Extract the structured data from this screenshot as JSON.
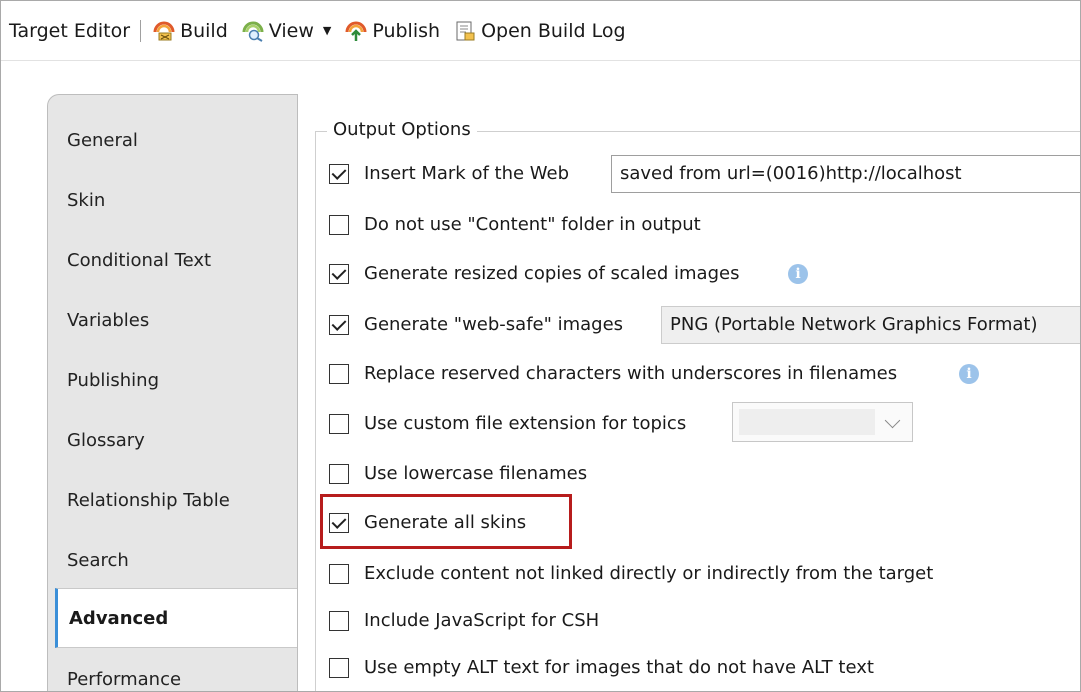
{
  "toolbar": {
    "title": "Target Editor",
    "build": "Build",
    "view": "View",
    "publish": "Publish",
    "open_build_log": "Open Build Log"
  },
  "tabs": [
    {
      "label": "General"
    },
    {
      "label": "Skin"
    },
    {
      "label": "Conditional Text"
    },
    {
      "label": "Variables"
    },
    {
      "label": "Publishing"
    },
    {
      "label": "Glossary"
    },
    {
      "label": "Relationship Table"
    },
    {
      "label": "Search"
    },
    {
      "label": "Advanced",
      "active": true
    },
    {
      "label": "Performance"
    }
  ],
  "output_options": {
    "title": "Output Options",
    "mark_of_web": {
      "label": "Insert Mark of the Web",
      "checked": true,
      "value": "saved from url=(0016)http://localhost"
    },
    "no_content_folder": {
      "label": "Do not use \"Content\" folder in output",
      "checked": false
    },
    "resized_copies": {
      "label": "Generate resized copies of scaled images",
      "checked": true
    },
    "web_safe": {
      "label": "Generate \"web-safe\" images",
      "checked": true,
      "format": "PNG (Portable Network Graphics Format)"
    },
    "replace_reserved": {
      "label": "Replace reserved characters with underscores in filenames",
      "checked": false
    },
    "custom_extension": {
      "label": "Use custom file extension for topics",
      "checked": false,
      "value": ""
    },
    "lowercase": {
      "label": "Use lowercase filenames",
      "checked": false
    },
    "all_skins": {
      "label": "Generate all skins",
      "checked": true
    },
    "exclude_unlinked": {
      "label": "Exclude content not linked directly or indirectly from the target",
      "checked": false
    },
    "javascript_csh": {
      "label": "Include JavaScript for CSH",
      "checked": false
    },
    "empty_alt": {
      "label": "Use empty ALT text for images that do not have ALT text",
      "checked": false
    }
  },
  "colors": {
    "highlight": "#b71c1c",
    "tab_strip": "#e6e6e6",
    "info_icon": "#9cc3ea"
  }
}
